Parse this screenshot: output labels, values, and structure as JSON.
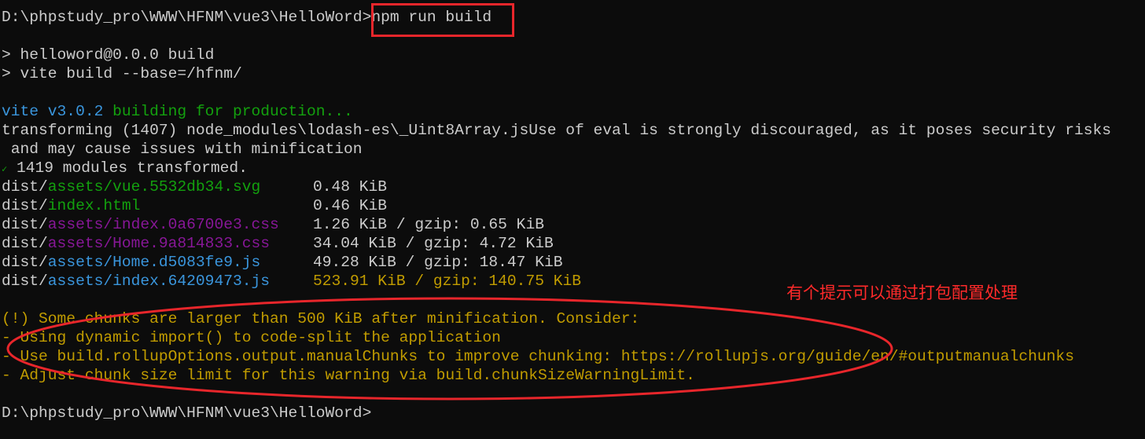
{
  "prompt": "D:\\phpstudy_pro\\WWW\\HFNM\\vue3\\HelloWord>",
  "command": "npm run build",
  "script_lines": [
    "> helloword@0.0.0 build",
    "> vite build --base=/hfnm/"
  ],
  "vite_version": "vite v3.0.2",
  "building": " building for production...",
  "transform_line": "transforming (1407) node_modules\\lodash-es\\_Uint8Array.jsUse of eval is strongly discouraged, as it poses security risks",
  "transform_line_cont": " and may cause issues with minification",
  "check_mark": "✓",
  "modules": " 1419 modules transformed.",
  "files": [
    {
      "dir": "dist/",
      "name": "assets/vue.5532db34.svg",
      "color": "green",
      "size": "0.48 KiB",
      "size_color": "default"
    },
    {
      "dir": "dist/",
      "name": "index.html",
      "color": "green",
      "size": "0.46 KiB",
      "size_color": "default"
    },
    {
      "dir": "dist/",
      "name": "assets/index.0a6700e3.css",
      "color": "purple",
      "size": "1.26 KiB / gzip: 0.65 KiB",
      "size_color": "default"
    },
    {
      "dir": "dist/",
      "name": "assets/Home.9a814833.css",
      "color": "purple",
      "size": "34.04 KiB / gzip: 4.72 KiB",
      "size_color": "default"
    },
    {
      "dir": "dist/",
      "name": "assets/Home.d5083fe9.js",
      "color": "blue",
      "size": "49.28 KiB / gzip: 18.47 KiB",
      "size_color": "default"
    },
    {
      "dir": "dist/",
      "name": "assets/index.64209473.js",
      "color": "blue",
      "size": "523.91 KiB / gzip: 140.75 KiB",
      "size_color": "yellow"
    }
  ],
  "warning_lines": [
    "(!) Some chunks are larger than 500 KiB after minification. Consider:",
    "- Using dynamic import() to code-split the application",
    "- Use build.rollupOptions.output.manualChunks to improve chunking: https://rollupjs.org/guide/en/#outputmanualchunks",
    "- Adjust chunk size limit for this warning via build.chunkSizeWarningLimit."
  ],
  "annotation": "有个提示可以通过打包配置处理",
  "colors": {
    "background": "#0c0c0c",
    "text": "#cccccc",
    "blue": "#3a96dd",
    "green": "#13a10e",
    "purple": "#881798",
    "yellow": "#c19c00",
    "annotation_red": "#e8262b"
  }
}
